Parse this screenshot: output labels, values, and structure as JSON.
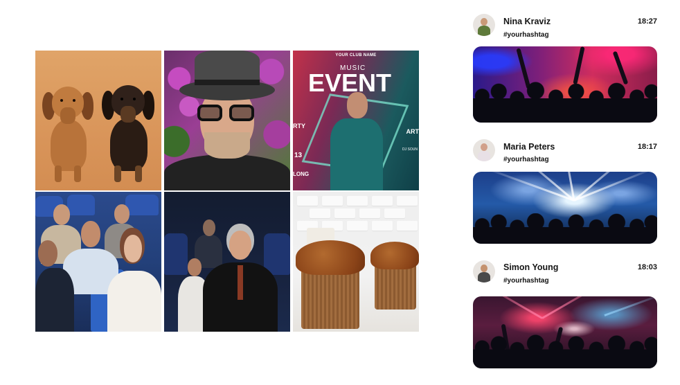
{
  "grid": {
    "tiles": [
      {
        "subject": "dachshunds"
      },
      {
        "subject": "man-with-hat"
      },
      {
        "subject": "event-poster",
        "club": "YOUR CLUB NAME",
        "music": "MUSIC",
        "title": "EVENT",
        "side_left": "RTY",
        "side_right": "ART",
        "number": "13",
        "lower_left": "LONG",
        "small_right": "DJ SOUN"
      },
      {
        "subject": "audience"
      },
      {
        "subject": "woman-in-theater"
      },
      {
        "subject": "panettone"
      }
    ]
  },
  "feed": {
    "posts": [
      {
        "name": "Nina Kraviz",
        "time": "18:27",
        "hashtag": "#yourhashtag",
        "image": "party-crowd"
      },
      {
        "name": "Maria Peters",
        "time": "18:17",
        "hashtag": "#yourhashtag",
        "image": "concert-lights"
      },
      {
        "name": "Simon Young",
        "time": "18:03",
        "hashtag": "#yourhashtag",
        "image": "festival-stage"
      }
    ]
  },
  "colors": {
    "background": "#ffffff",
    "text": "#151515",
    "poster_accent": "#c2314a"
  }
}
